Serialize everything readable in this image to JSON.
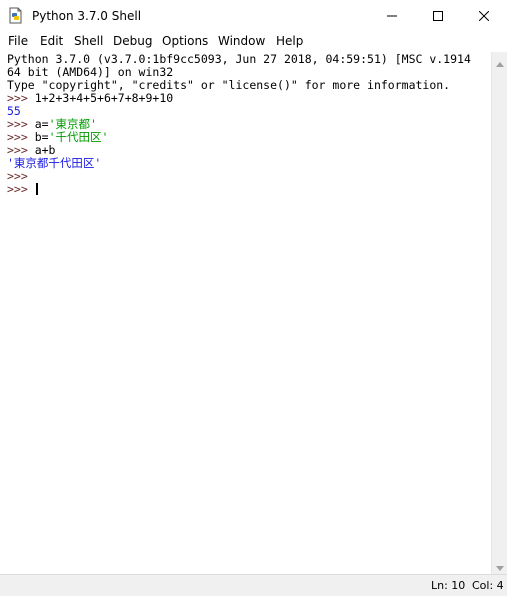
{
  "window": {
    "title": "Python 3.7.0 Shell",
    "icon": "python-idle-icon",
    "controls": [
      "minimize-icon",
      "maximize-icon",
      "close-icon"
    ]
  },
  "menu": [
    "File",
    "Edit",
    "Shell",
    "Debug",
    "Options",
    "Window",
    "Help"
  ],
  "shell": {
    "banner_line1": "Python 3.7.0 (v3.7.0:1bf9cc5093, Jun 27 2018, 04:59:51) [MSC v.1914",
    "banner_line2": "64 bit (AMD64)] on win32",
    "banner_line3": "Type \"copyright\", \"credits\" or \"license()\" for more information.",
    "prompt": ">>> ",
    "cmd1": "1+2+3+4+5+6+7+8+9+10",
    "out1": "55",
    "cmd2_prefix": "a=",
    "cmd2_str": "'東京都'",
    "cmd3_prefix": "b=",
    "cmd3_str": "'千代田区'",
    "cmd4": "a+b",
    "out4": "'東京都千代田区'",
    "prompt_empty": ">>>",
    "prompt_active": ">>> "
  },
  "status": {
    "line": "Ln: 10",
    "col": "Col: 4"
  },
  "colors": {
    "prompt": "#6b2d2d",
    "string": "#009c00",
    "result": "#1a1ae0"
  }
}
